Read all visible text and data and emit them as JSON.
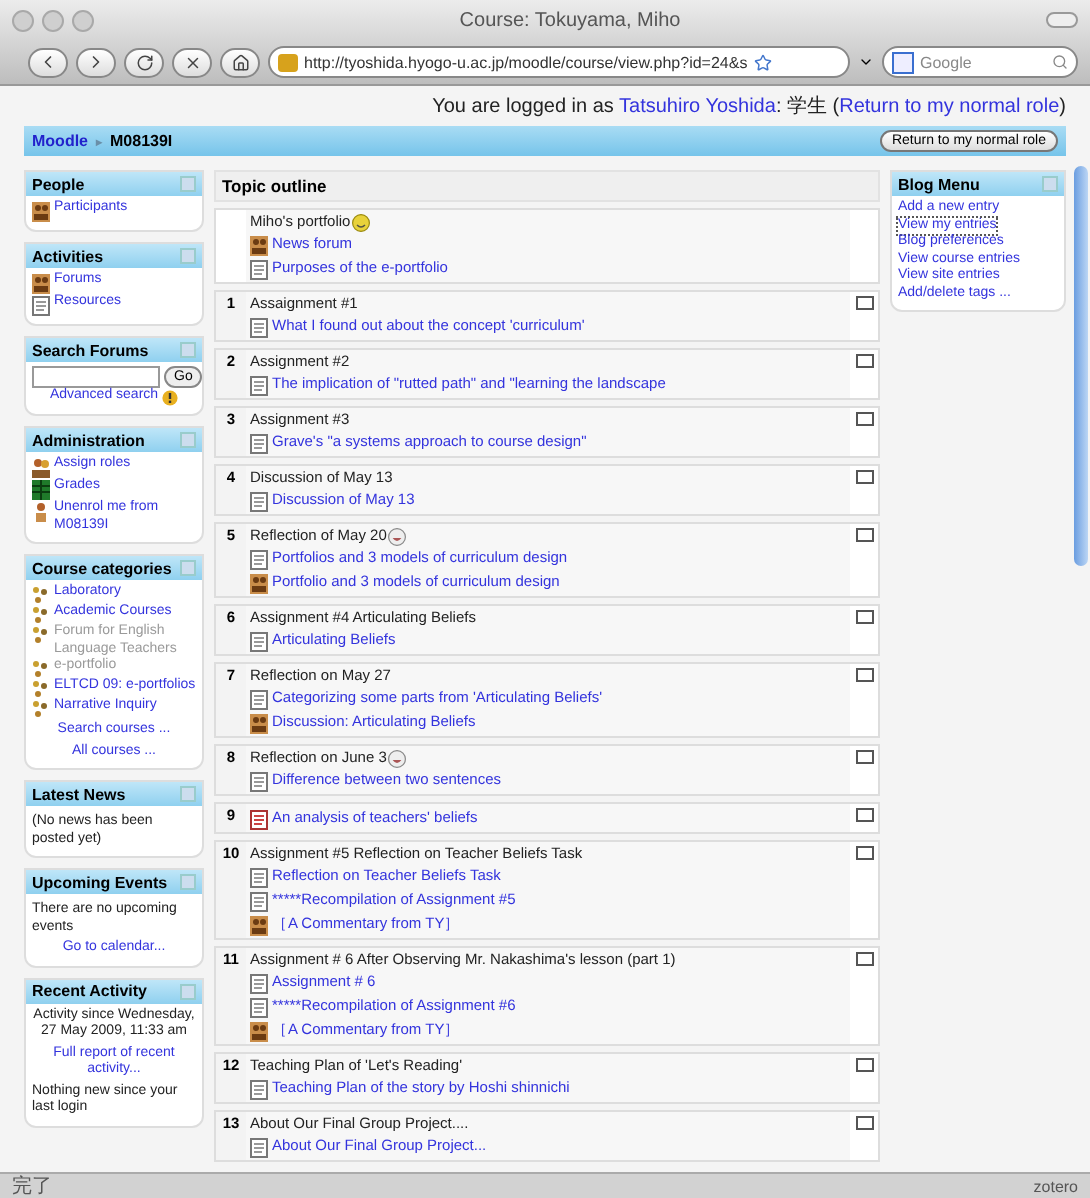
{
  "browser": {
    "title": "Course: Tokuyama, Miho",
    "url": "http://tyoshida.hyogo-u.ac.jp/moodle/course/view.php?id=24&s",
    "search_placeholder": "Google"
  },
  "login": {
    "before": "You are logged in as ",
    "user": "Tatsuhiro Yoshida",
    "middle": ": 学生 (",
    "link": "Return to my normal role",
    "after": ")"
  },
  "navbar": {
    "crumbs": [
      "Moodle",
      "M08139I"
    ],
    "separator": "▸",
    "button": "Return to my normal role"
  },
  "left_blocks": [
    {
      "title": "People",
      "parts": [
        {
          "kind": "forum",
          "text": "Participants"
        }
      ]
    },
    {
      "title": "Activities",
      "parts": [
        {
          "kind": "forum",
          "text": "Forums"
        },
        {
          "kind": "resource",
          "text": "Resources"
        }
      ]
    },
    {
      "title": "Search Forums",
      "parts": [
        {
          "kind": "search",
          "button": "Go",
          "link": "Advanced search"
        }
      ]
    },
    {
      "title": "Administration",
      "parts": [
        {
          "kind": "roles",
          "text": "Assign roles"
        },
        {
          "kind": "grades",
          "text": "Grades"
        },
        {
          "kind": "unenrol",
          "text": "Unenrol me from M08139I"
        }
      ]
    },
    {
      "title": "Course categories",
      "parts": [
        {
          "kind": "category",
          "text": "Laboratory",
          "dimmed": false
        },
        {
          "kind": "category",
          "text": "Academic Courses",
          "dimmed": false
        },
        {
          "kind": "category",
          "text": "Forum for English Language Teachers",
          "dimmed": true
        },
        {
          "kind": "category",
          "text": "e-portfolio",
          "dimmed": true
        },
        {
          "kind": "category",
          "text": "ELTCD 09: e-portfolios",
          "dimmed": false
        },
        {
          "kind": "category",
          "text": "Narrative Inquiry",
          "dimmed": false
        },
        {
          "kind": "center_link",
          "text": "Search courses ..."
        },
        {
          "kind": "center_link",
          "text": "All courses ..."
        }
      ]
    },
    {
      "title": "Latest News",
      "parts": [
        {
          "kind": "text",
          "text": "(No news has been posted yet)"
        }
      ]
    },
    {
      "title": "Upcoming Events",
      "parts": [
        {
          "kind": "text",
          "text": "There are no upcoming events"
        },
        {
          "kind": "center_link",
          "text": "Go to calendar..."
        }
      ]
    },
    {
      "title": "Recent Activity",
      "parts": [
        {
          "kind": "center_text",
          "text": "Activity since Wednesday, 27 May 2009, 11:33 am"
        },
        {
          "kind": "center_link",
          "text": "Full report of recent activity..."
        },
        {
          "kind": "text",
          "text": "Nothing new since your last login"
        }
      ]
    }
  ],
  "topic_heading": "Topic outline",
  "sections": [
    {
      "kind": "smiley",
      "title": "Miho's portfolio",
      "items": [
        {
          "kind": "forum",
          "text": "News forum"
        },
        {
          "kind": "resource",
          "text": "Purposes of the e-portfolio"
        }
      ]
    },
    {
      "kind": "plain",
      "number": "1",
      "title": "Assaignment #1",
      "items": [
        {
          "kind": "resource",
          "text": "What I found out about the concept 'curriculum'"
        }
      ]
    },
    {
      "kind": "plain",
      "number": "2",
      "title": "Assignment #2",
      "items": [
        {
          "kind": "resource",
          "text": "The implication of \"rutted path\" and \"learning the landscape"
        }
      ]
    },
    {
      "kind": "plain",
      "number": "3",
      "title": "Assignment #3",
      "items": [
        {
          "kind": "resource",
          "text": "Grave's \"a systems approach to course design\""
        }
      ]
    },
    {
      "kind": "plain",
      "number": "4",
      "title": "Discussion of May 13",
      "items": [
        {
          "kind": "resource",
          "text": "Discussion of May 13"
        }
      ]
    },
    {
      "kind": "grin",
      "number": "5",
      "title": "Reflection of May 20",
      "items": [
        {
          "kind": "resource",
          "text": "Portfolios and 3 models of curriculum design"
        },
        {
          "kind": "forum",
          "text": "Portfolio and 3 models of curriculum design"
        }
      ]
    },
    {
      "kind": "plain",
      "number": "6",
      "title": "Assignment #4 Articulating Beliefs",
      "items": [
        {
          "kind": "resource",
          "text": "Articulating Beliefs"
        }
      ]
    },
    {
      "kind": "plain",
      "number": "7",
      "title": "Reflection on May 27",
      "items": [
        {
          "kind": "resource",
          "text": "Categorizing some parts from 'Articulating Beliefs'"
        },
        {
          "kind": "forum",
          "text": "Discussion: Articulating Beliefs"
        }
      ]
    },
    {
      "kind": "grin",
      "number": "8",
      "title": "Reflection on June 3",
      "items": [
        {
          "kind": "resource",
          "text": "Difference between two sentences"
        }
      ]
    },
    {
      "number": "9",
      "items": [
        {
          "kind": "pdf",
          "text": "An analysis of teachers' beliefs"
        }
      ]
    },
    {
      "kind": "plain",
      "number": "10",
      "title": "Assignment #5 Reflection on Teacher Beliefs Task",
      "items": [
        {
          "kind": "resource",
          "text": "Reflection on Teacher Beliefs Task"
        },
        {
          "kind": "resource",
          "text": "*****Recompilation of Assignment #5"
        },
        {
          "kind": "forum",
          "text": "［A Commentary from TY］"
        }
      ]
    },
    {
      "kind": "plain",
      "number": "11",
      "title": "Assignment # 6 After Observing Mr. Nakashima's lesson (part 1)",
      "items": [
        {
          "kind": "resource",
          "text": "Assignment # 6"
        },
        {
          "kind": "resource",
          "text": "*****Recompilation of Assignment #6"
        },
        {
          "kind": "forum",
          "text": "［A Commentary from TY］"
        }
      ]
    },
    {
      "kind": "plain",
      "number": "12",
      "title": "Teaching Plan of 'Let's Reading'",
      "items": [
        {
          "kind": "resource",
          "text": "Teaching Plan of the story by Hoshi shinnichi"
        }
      ]
    },
    {
      "kind": "plain",
      "number": "13",
      "title": "About Our Final Group Project....",
      "items": [
        {
          "kind": "resource",
          "text": "About Our Final Group Project..."
        }
      ]
    }
  ],
  "right_blocks": [
    {
      "title": "Blog Menu",
      "parts": [
        {
          "kind": "link",
          "text": "Add a new entry",
          "selected": false
        },
        {
          "kind": "link",
          "text": "View my entries",
          "selected": true
        },
        {
          "kind": "link",
          "text": "Blog preferences",
          "selected": false
        },
        {
          "kind": "link",
          "text": "View course entries",
          "selected": false
        },
        {
          "kind": "link",
          "text": "View site entries",
          "selected": false
        },
        {
          "kind": "link",
          "text": "Add/delete tags ...",
          "selected": false
        }
      ]
    }
  ],
  "status_bar": {
    "text": "完了",
    "right": "zotero"
  }
}
